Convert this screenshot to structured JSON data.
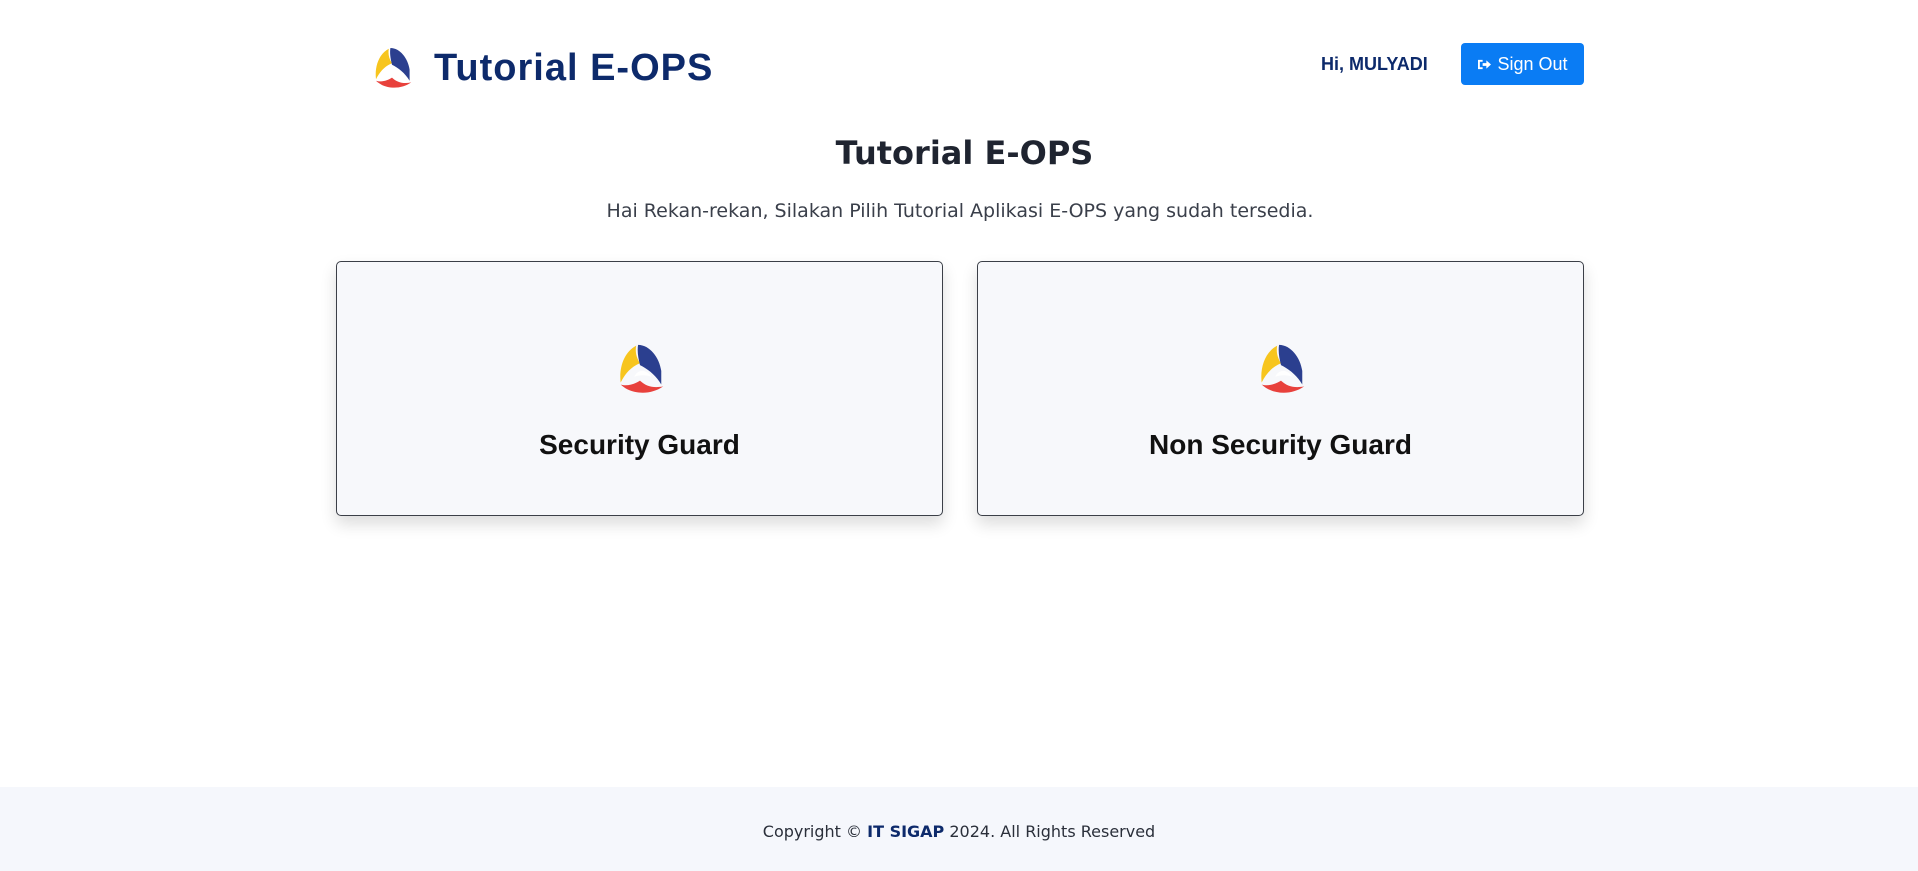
{
  "header": {
    "brand_title": "Tutorial E-OPS",
    "logo_icon": "tri-color-swirl-logo",
    "greeting": "Hi, MULYADI",
    "signout_label": "Sign Out",
    "signout_icon": "sign-out-icon"
  },
  "main": {
    "title": "Tutorial E-OPS",
    "subtitle": "Hai Rekan-rekan, Silakan Pilih Tutorial Aplikasi E-OPS yang sudah tersedia.",
    "cards": [
      {
        "label": "Security Guard",
        "icon": "tri-color-swirl-logo"
      },
      {
        "label": "Non Security Guard",
        "icon": "tri-color-swirl-logo"
      }
    ]
  },
  "footer": {
    "copyright_prefix": "Copyright ©",
    "company": "IT SIGAP",
    "copyright_suffix": "2024. All Rights Reserved"
  },
  "colors": {
    "brand_navy": "#0d2a6b",
    "signout_blue": "#0a7cf4",
    "logo_yellow": "#f7c51e",
    "logo_red": "#e8413c",
    "logo_blue": "#2b3f8f",
    "card_background": "#f7f8fb",
    "footer_background": "#f5f7fc"
  }
}
